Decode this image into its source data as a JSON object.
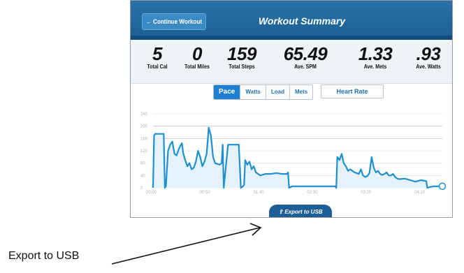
{
  "header": {
    "back_label": "← Continue Workout",
    "title": "Workout Summary"
  },
  "stats": [
    {
      "value": "5",
      "label": "Total Cal"
    },
    {
      "value": "0",
      "label": "Total Miles"
    },
    {
      "value": "159",
      "label": "Total Steps"
    },
    {
      "value": "65.49",
      "label": "Ave. SPM"
    },
    {
      "value": "1.33",
      "label": "Ave. Mets"
    },
    {
      "value": ".93",
      "label": "Ave. Watts"
    }
  ],
  "tabs": [
    {
      "label": "Pace",
      "active": true
    },
    {
      "label": "Watts",
      "active": false
    },
    {
      "label": "Load",
      "active": false
    },
    {
      "label": "Mets",
      "active": false
    }
  ],
  "heart_rate_label": "Heart Rate",
  "export_label": "Export to USB",
  "callout_label": "Export to USB",
  "colors": {
    "accent": "#1f7fd0",
    "header": "#1c5f93",
    "line": "#1e90d0"
  },
  "chart_data": {
    "type": "line",
    "yticks": [
      "240",
      "200",
      "160",
      "120",
      "80",
      "40",
      "0"
    ],
    "xticks": [
      "00:00",
      "00:50",
      "01:40",
      "02:30",
      "03:20",
      "04:10"
    ],
    "ylim": [
      0,
      240
    ],
    "xlim": [
      0,
      270
    ],
    "grid": true,
    "series": [
      {
        "x": [
          0,
          1,
          2,
          10,
          11,
          12,
          14,
          16,
          18,
          20,
          22,
          24,
          26,
          27,
          28,
          30,
          32,
          34,
          36,
          38,
          40,
          42,
          44,
          46,
          48,
          50,
          52,
          54,
          56,
          58,
          62,
          64,
          65,
          66,
          70,
          80,
          82,
          84,
          85,
          86,
          88,
          90,
          92,
          94,
          96,
          98,
          100,
          105,
          110,
          115,
          120,
          125,
          126,
          127,
          130,
          170,
          171,
          172,
          174,
          176,
          178,
          180,
          182,
          184,
          186,
          188,
          190,
          192,
          194,
          196,
          198,
          200,
          202,
          204,
          206,
          208,
          210,
          212,
          214,
          216,
          218,
          220,
          222,
          224,
          226,
          228,
          230,
          235,
          240,
          245,
          250,
          255,
          256,
          258,
          262,
          270
        ],
        "y": [
          0,
          170,
          175,
          175,
          0,
          5,
          120,
          140,
          150,
          110,
          105,
          125,
          140,
          145,
          115,
          90,
          70,
          80,
          60,
          65,
          85,
          120,
          100,
          70,
          85,
          110,
          195,
          170,
          100,
          80,
          75,
          80,
          140,
          0,
          140,
          140,
          0,
          5,
          10,
          90,
          75,
          85,
          60,
          70,
          50,
          45,
          40,
          45,
          45,
          48,
          45,
          45,
          50,
          0,
          5,
          5,
          0,
          100,
          90,
          110,
          80,
          70,
          55,
          60,
          55,
          50,
          48,
          45,
          60,
          40,
          35,
          38,
          48,
          100,
          65,
          50,
          55,
          45,
          42,
          45,
          50,
          40,
          40,
          45,
          35,
          30,
          28,
          30,
          25,
          20,
          25,
          22,
          0,
          2,
          5,
          5
        ]
      }
    ]
  }
}
